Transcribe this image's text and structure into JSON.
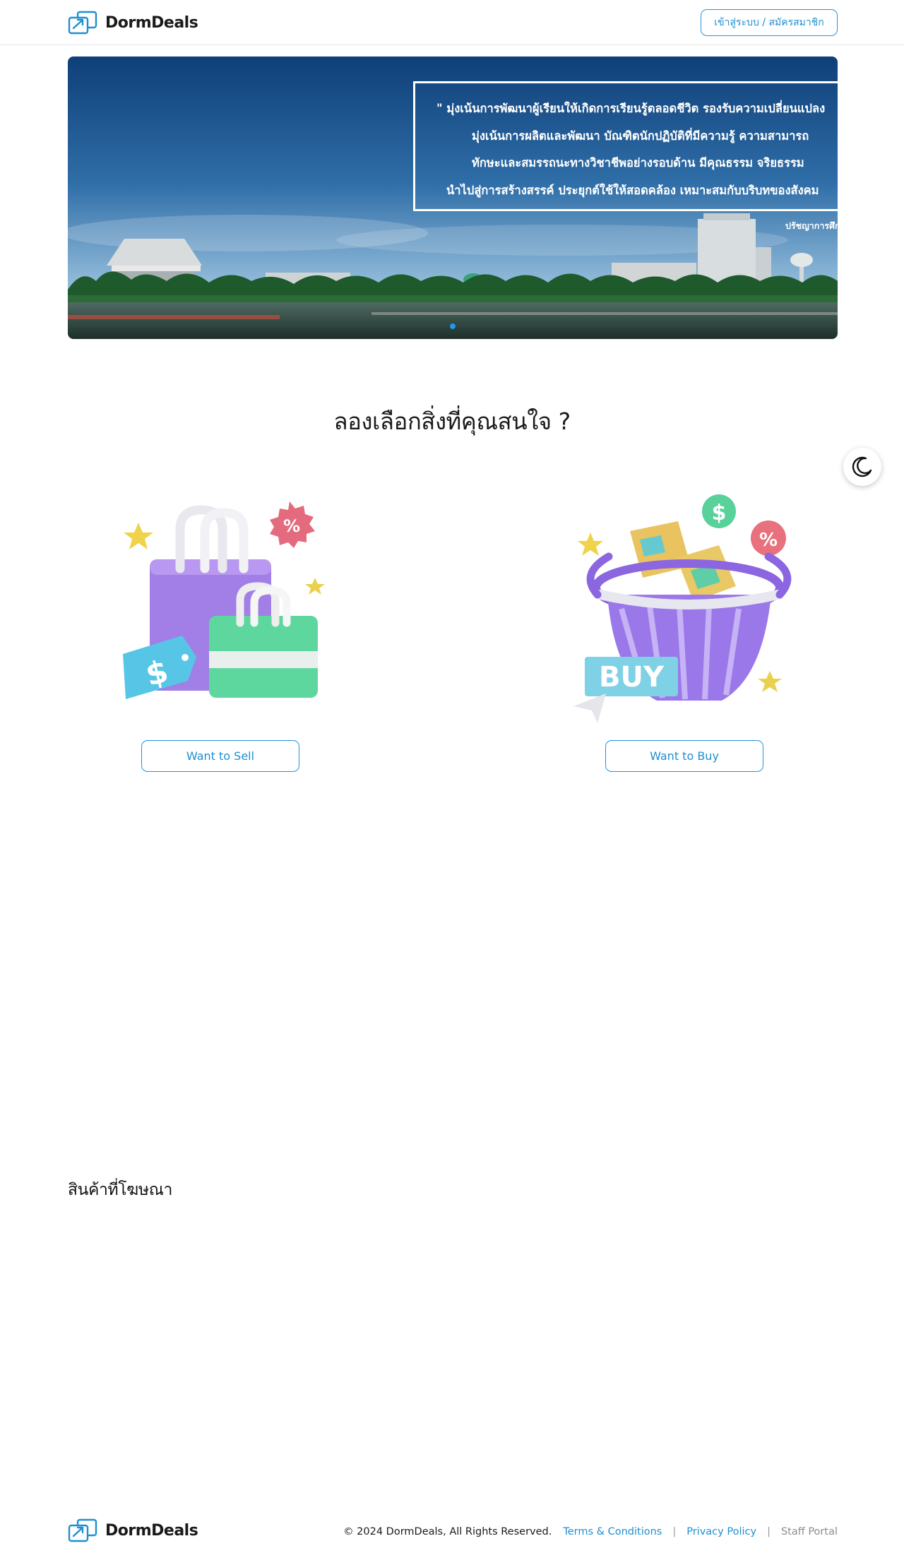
{
  "header": {
    "brand_name": "DormDeals",
    "login_label": "เข้าสู่ระบบ / สมัครสมาชิก"
  },
  "hero": {
    "quote_lines": [
      "\" มุ่งเน้นการพัฒนาผู้เรียนให้เกิดการเรียนรู้ตลอดชีวิต รองรับความเปลี่ยนแปลง",
      "มุ่งเน้นการผลิตและพัฒนา บัณฑิตนักปฏิบัติที่มีความรู้ ความสามารถ",
      "ทักษะและสมรรถนะทางวิชาชีพอย่างรอบด้าน มีคุณธรรม จริยธรรม",
      "นำไปสู่การสร้างสรรค์ ประยุกต์ใช้ให้สอดคล้อง เหมาะสมกับบริบทของสังคม"
    ],
    "caption": "ปรัชญาการศึกษา",
    "slide_count": 3,
    "active_slide": 1
  },
  "choice_section": {
    "title": "ลองเลือกสิ่งที่คุณสนใจ ?",
    "sell_label": "Want to Sell",
    "buy_label": "Want to Buy",
    "buy_badge_text": "BUY"
  },
  "theme_toggle": {
    "icon": "moon-icon"
  },
  "ads": {
    "title": "สินค้าที่โฆษณา"
  },
  "footer": {
    "brand_name": "DormDeals",
    "copyright": "© 2024 DormDeals, All Rights Reserved.",
    "terms_label": "Terms & Conditions",
    "privacy_label": "Privacy Policy",
    "staff_label": "Staff Portal",
    "separator": "|"
  },
  "colors": {
    "accent": "#1e8fd1",
    "text": "#111111",
    "muted": "#8c8c8c"
  }
}
